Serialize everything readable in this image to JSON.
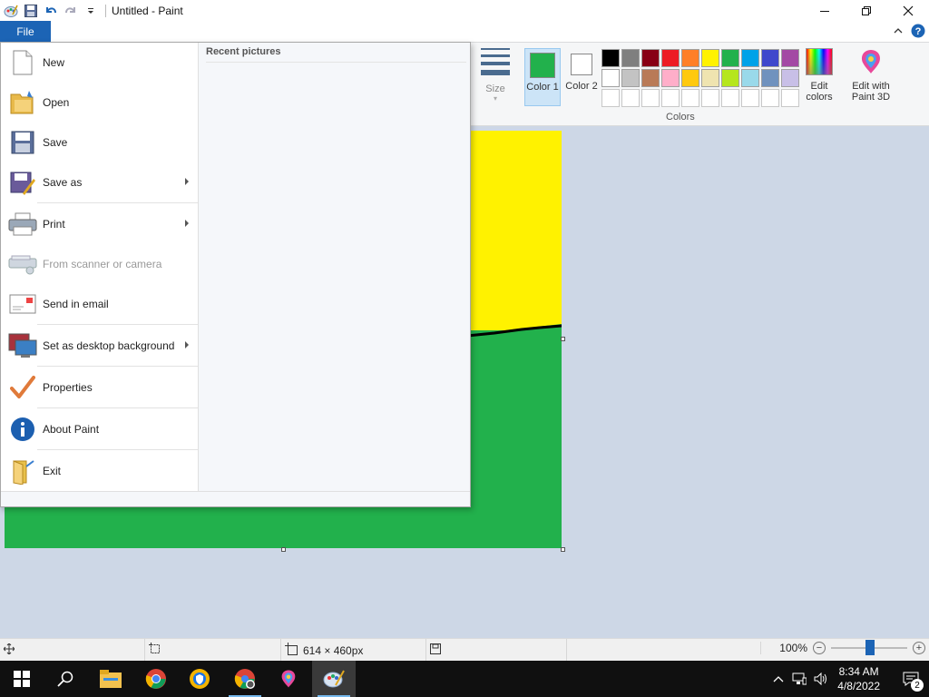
{
  "window": {
    "title": "Untitled - Paint"
  },
  "tabs": {
    "file": "File"
  },
  "ribbon": {
    "size_label": "Size",
    "color1_label": "Color 1",
    "color2_label": "Color 2",
    "colors_group_label": "Colors",
    "edit_colors_label": "Edit colors",
    "edit_paint3d_label": "Edit with Paint 3D",
    "color1_value": "#22b14c",
    "color2_value": "#ffffff",
    "palette": [
      "#000000",
      "#7f7f7f",
      "#880015",
      "#ed1c24",
      "#ff7f27",
      "#fff200",
      "#22b14c",
      "#00a2e8",
      "#3f48cc",
      "#a349a4",
      "#ffffff",
      "#c3c3c3",
      "#b97a57",
      "#ffaec9",
      "#ffc90e",
      "#efe4b0",
      "#b5e61d",
      "#99d9ea",
      "#7092be",
      "#c8bfe7"
    ]
  },
  "file_menu": {
    "recent_title": "Recent pictures",
    "items": [
      {
        "label": "New",
        "icon": "new-icon",
        "enabled": true,
        "submenu": false
      },
      {
        "label": "Open",
        "icon": "open-icon",
        "enabled": true,
        "submenu": false
      },
      {
        "label": "Save",
        "icon": "save-icon",
        "enabled": true,
        "submenu": false
      },
      {
        "label": "Save as",
        "icon": "save-as-icon",
        "enabled": true,
        "submenu": true
      },
      {
        "label": "Print",
        "icon": "print-icon",
        "enabled": true,
        "submenu": true
      },
      {
        "label": "From scanner or camera",
        "icon": "scanner-icon",
        "enabled": false,
        "submenu": false
      },
      {
        "label": "Send in email",
        "icon": "email-icon",
        "enabled": true,
        "submenu": false
      },
      {
        "label": "Set as desktop background",
        "icon": "desktop-background-icon",
        "enabled": true,
        "submenu": true
      },
      {
        "label": "Properties",
        "icon": "checkmark-icon",
        "enabled": true,
        "submenu": false
      },
      {
        "label": "About Paint",
        "icon": "info-icon",
        "enabled": true,
        "submenu": false
      },
      {
        "label": "Exit",
        "icon": "exit-icon",
        "enabled": true,
        "submenu": false
      }
    ]
  },
  "canvas": {
    "top_color": "#fff200",
    "bottom_color": "#22b14c"
  },
  "status": {
    "image_size": "614 × 460px",
    "zoom": "100%"
  },
  "taskbar": {
    "time": "8:34 AM",
    "date": "4/8/2022",
    "notification_count": "2",
    "apps": [
      "start-icon",
      "search-icon",
      "file-explorer-icon",
      "chrome-icon",
      "browser-shield-icon",
      "chrome-profile-icon",
      "paint3d-icon",
      "paint-icon"
    ]
  }
}
